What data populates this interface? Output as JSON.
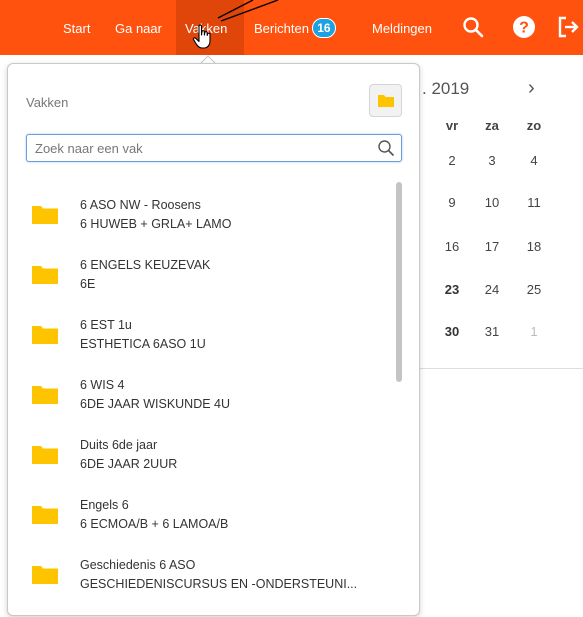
{
  "nav": {
    "start": "Start",
    "ganaar": "Ga naar",
    "vakken": "Vakken",
    "berichten": "Berichten",
    "berichten_count": "16",
    "meldingen": "Meldingen",
    "icons": [
      "search-icon",
      "help-icon",
      "logout-icon"
    ]
  },
  "calendar": {
    "title_fragment": ". 2019",
    "next": "›",
    "days": [
      "vr",
      "za",
      "zo"
    ],
    "weeks": [
      [
        "2",
        "3",
        "4"
      ],
      [
        "9",
        "10",
        "11"
      ],
      [
        "16",
        "17",
        "18"
      ],
      [
        "23",
        "24",
        "25"
      ],
      [
        "30",
        "31",
        "1"
      ]
    ]
  },
  "dropdown": {
    "title": "Vakken",
    "search_placeholder": "Zoek naar een vak",
    "courses": [
      {
        "name": "6 ASO NW - Roosens",
        "sub": "6 HUWEB + GRLA+ LAMO"
      },
      {
        "name": "6 ENGELS KEUZEVAK",
        "sub": "6E"
      },
      {
        "name": "6 EST 1u",
        "sub": "ESTHETICA 6ASO 1U"
      },
      {
        "name": "6 WIS 4",
        "sub": "6DE JAAR WISKUNDE 4U"
      },
      {
        "name": "Duits 6de jaar",
        "sub": "6DE JAAR 2UUR"
      },
      {
        "name": "Engels 6",
        "sub": "6 ECMOA/B + 6 LAMOA/B"
      },
      {
        "name": "Geschiedenis 6 ASO",
        "sub": "GESCHIEDENISCURSUS EN -ONDERSTEUNI..."
      }
    ]
  },
  "colors": {
    "accent": "#ff520e",
    "active_tab": "#e0460a",
    "badge": "#1ca1e2",
    "folder": "#ffc400"
  }
}
